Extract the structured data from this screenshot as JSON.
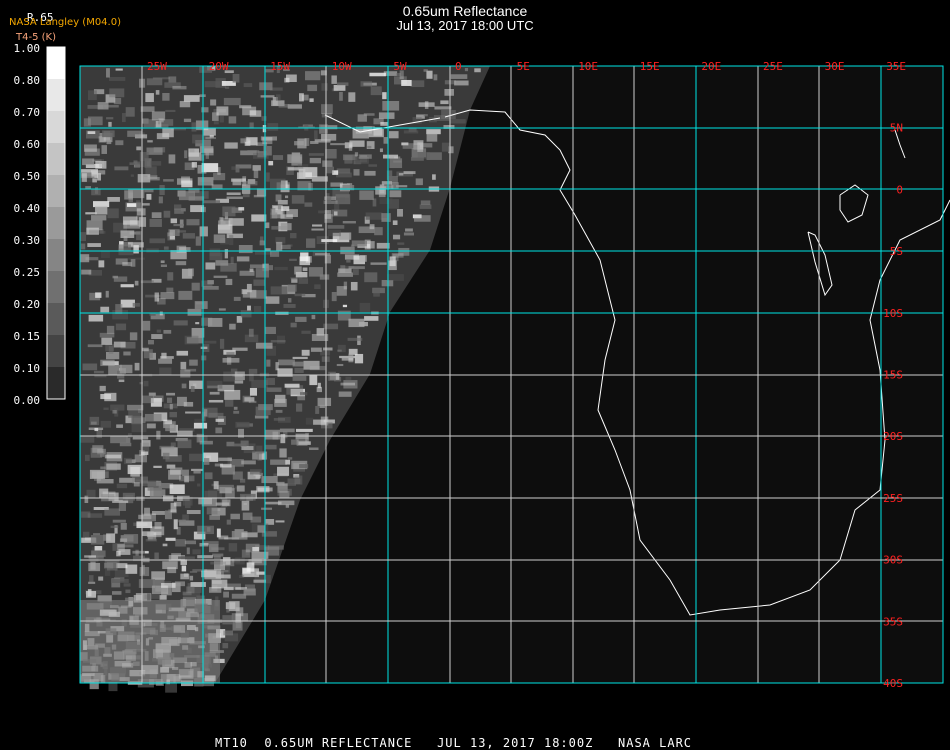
{
  "header": {
    "title": "0.65um Reflectance",
    "subtitle": "Jul 13, 2017 18:00 UTC",
    "org": "NASA Langley (M04.0)",
    "param": "R.65",
    "units": "T4-5 (K)"
  },
  "colorbar": {
    "labels": [
      "1.00",
      "0.80",
      "0.70",
      "0.60",
      "0.50",
      "0.40",
      "0.30",
      "0.25",
      "0.20",
      "0.15",
      "0.10",
      "0.00"
    ]
  },
  "map": {
    "lon_labels": [
      "25W",
      "20W",
      "15W",
      "10W",
      "5W",
      "0",
      "5E",
      "10E",
      "15E",
      "20E",
      "25E",
      "30E",
      "35E"
    ],
    "lat_labels": [
      "5N",
      "0",
      "5S",
      "10S",
      "15S",
      "20S",
      "25S",
      "30S",
      "35S",
      "40S"
    ],
    "label_color": "#ff2020",
    "grid_cyan": "#00e5e5"
  },
  "footer": "MT10  0.65UM REFLECTANCE   JUL 13, 2017 18:00Z   NASA LARC"
}
